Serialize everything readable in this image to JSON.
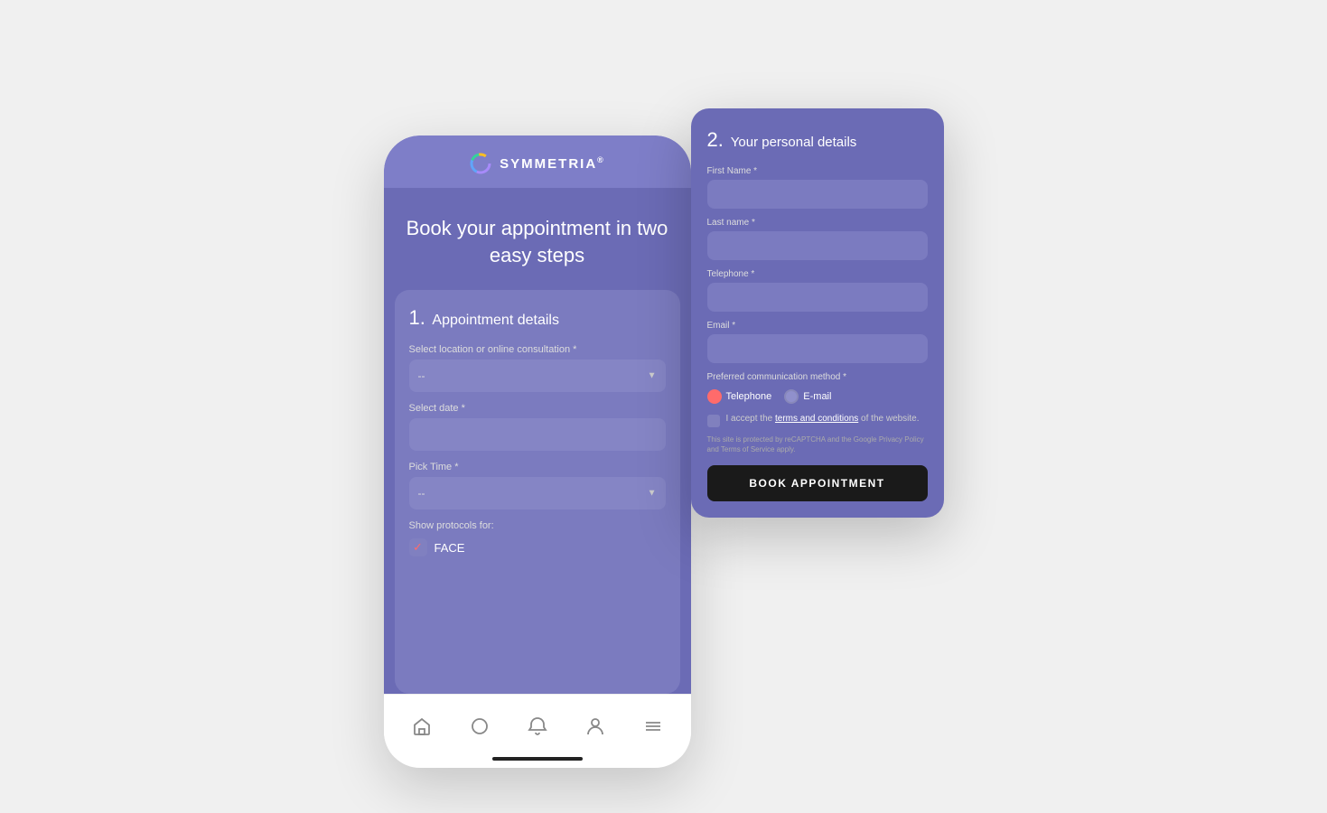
{
  "app": {
    "name": "SYMMETRIA",
    "trademark": "®"
  },
  "phone": {
    "hero": {
      "title": "Book your appointment in two easy steps"
    },
    "step1": {
      "number": "1.",
      "label": "Appointment details"
    },
    "fields": {
      "location_label": "Select location or online consultation *",
      "location_placeholder": "--",
      "date_label": "Select date *",
      "time_label": "Pick Time *",
      "time_placeholder": "--",
      "protocols_label": "Show protocols for:",
      "protocols_value": "FACE"
    },
    "nav": {
      "home": "⌂",
      "shape": "○",
      "bell": "🔔",
      "person": "👤",
      "menu": "☰"
    }
  },
  "card": {
    "step2": {
      "number": "2.",
      "label": "Your personal details"
    },
    "fields": {
      "first_name_label": "First Name *",
      "last_name_label": "Last name *",
      "telephone_label": "Telephone *",
      "email_label": "Email *"
    },
    "comm_method": {
      "label": "Preferred communication method *",
      "telephone": "Telephone",
      "email": "E-mail"
    },
    "terms": {
      "text_before": "I accept the ",
      "link_text": "terms and conditions",
      "text_after": " of the website."
    },
    "recaptcha": "This site is protected by reCAPTCHA and the Google Privacy Policy and Terms of Service apply.",
    "book_button": "BOOK APPOINTMENT"
  }
}
